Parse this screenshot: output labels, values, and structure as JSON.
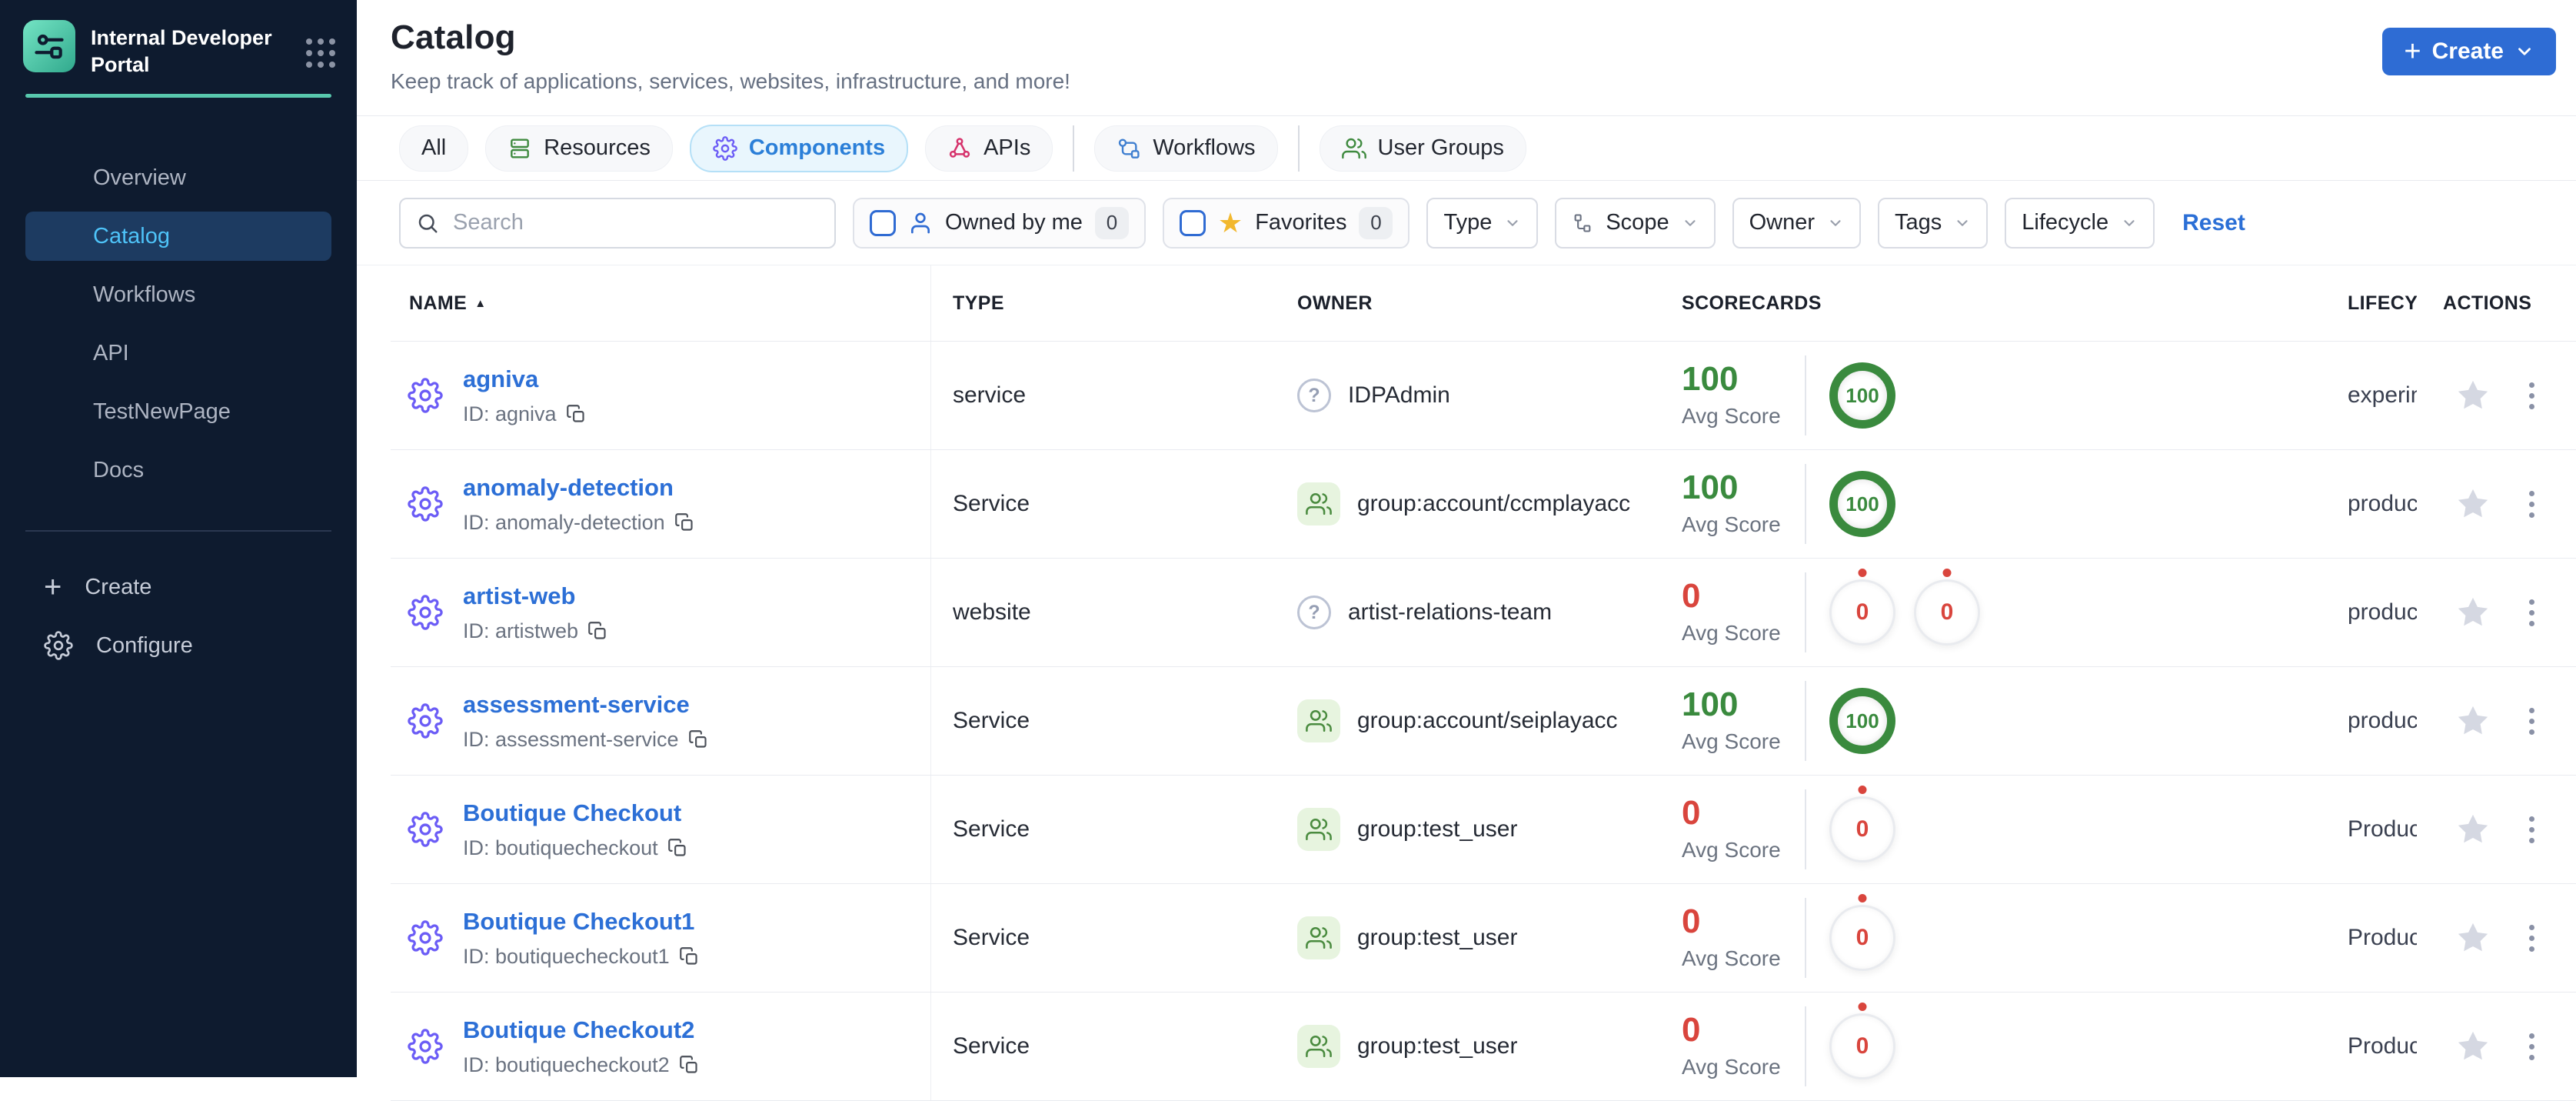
{
  "brand": {
    "title": "Internal Developer Portal"
  },
  "sidebar": {
    "items": [
      {
        "label": "Overview",
        "active": false
      },
      {
        "label": "Catalog",
        "active": true
      },
      {
        "label": "Workflows",
        "active": false
      },
      {
        "label": "API",
        "active": false
      },
      {
        "label": "TestNewPage",
        "active": false
      },
      {
        "label": "Docs",
        "active": false
      }
    ],
    "footer": {
      "create_label": "Create",
      "configure_label": "Configure"
    }
  },
  "header": {
    "title": "Catalog",
    "subtitle": "Keep track of applications, services, websites, infrastructure, and more!",
    "create_label": "Create"
  },
  "tabs": [
    {
      "label": "All",
      "icon": null,
      "selected": false
    },
    {
      "label": "Resources",
      "icon": "resources-icon",
      "selected": false
    },
    {
      "label": "Components",
      "icon": "components-icon",
      "selected": true
    },
    {
      "label": "APIs",
      "icon": "apis-icon",
      "selected": false
    },
    {
      "label": "Workflows",
      "icon": "workflows-icon",
      "selected": false
    },
    {
      "label": "User Groups",
      "icon": "user-groups-icon",
      "selected": false
    }
  ],
  "filters": {
    "search_placeholder": "Search",
    "owned_by_me": {
      "label": "Owned by me",
      "count": "0"
    },
    "favorites": {
      "label": "Favorites",
      "count": "0"
    },
    "dropdowns": {
      "type": "Type",
      "scope": "Scope",
      "owner": "Owner",
      "tags": "Tags",
      "lifecycle": "Lifecycle"
    },
    "reset_label": "Reset"
  },
  "table": {
    "columns": {
      "name": "NAME",
      "type": "TYPE",
      "owner": "OWNER",
      "scorecards": "SCORECARDS",
      "lifecycle": "LIFECYCLE",
      "actions": "ACTIONS"
    },
    "avg_score_label": "Avg Score",
    "rows": [
      {
        "name": "agniva",
        "id_label": "ID: agniva",
        "type": "service",
        "owner": {
          "kind": "user",
          "label": "IDPAdmin"
        },
        "score": {
          "avg": "100",
          "state": "good",
          "rings": [
            {
              "value": "100",
              "state": "good"
            }
          ]
        },
        "lifecycle": "experimental"
      },
      {
        "name": "anomaly-detection",
        "id_label": "ID: anomaly-detection",
        "type": "Service",
        "owner": {
          "kind": "group",
          "label": "group:account/ccmplayacc"
        },
        "score": {
          "avg": "100",
          "state": "good",
          "rings": [
            {
              "value": "100",
              "state": "good"
            }
          ]
        },
        "lifecycle": "production"
      },
      {
        "name": "artist-web",
        "id_label": "ID: artistweb",
        "type": "website",
        "owner": {
          "kind": "user",
          "label": "artist-relations-team"
        },
        "score": {
          "avg": "0",
          "state": "bad",
          "rings": [
            {
              "value": "0",
              "state": "bad"
            },
            {
              "value": "0",
              "state": "bad"
            }
          ]
        },
        "lifecycle": "production"
      },
      {
        "name": "assessment-service",
        "id_label": "ID: assessment-service",
        "type": "Service",
        "owner": {
          "kind": "group",
          "label": "group:account/seiplayacc"
        },
        "score": {
          "avg": "100",
          "state": "good",
          "rings": [
            {
              "value": "100",
              "state": "good"
            }
          ]
        },
        "lifecycle": "production"
      },
      {
        "name": "Boutique Checkout",
        "id_label": "ID: boutiquecheckout",
        "type": "Service",
        "owner": {
          "kind": "group",
          "label": "group:test_user"
        },
        "score": {
          "avg": "0",
          "state": "bad",
          "rings": [
            {
              "value": "0",
              "state": "bad"
            }
          ]
        },
        "lifecycle": "Production"
      },
      {
        "name": "Boutique Checkout1",
        "id_label": "ID: boutiquecheckout1",
        "type": "Service",
        "owner": {
          "kind": "group",
          "label": "group:test_user"
        },
        "score": {
          "avg": "0",
          "state": "bad",
          "rings": [
            {
              "value": "0",
              "state": "bad"
            }
          ]
        },
        "lifecycle": "Production"
      },
      {
        "name": "Boutique Checkout2",
        "id_label": "ID: boutiquecheckout2",
        "type": "Service",
        "owner": {
          "kind": "group",
          "label": "group:test_user"
        },
        "score": {
          "avg": "0",
          "state": "bad",
          "rings": [
            {
              "value": "0",
              "state": "bad"
            }
          ]
        },
        "lifecycle": "Production"
      }
    ]
  },
  "colors": {
    "accent_blue": "#2e6cd4",
    "link_blue": "#2c6fd6",
    "selected_tab_blue": "#2b7fd8",
    "good_green": "#3a8a3e",
    "bad_red": "#d9453d",
    "teal_accent": "#58c8ad",
    "component_purple": "#6b5cf6",
    "api_pink": "#d6336c",
    "resource_green": "#3f8a3f",
    "workflow_blue": "#3f7fd0",
    "sidebar_bg": "#0e1b2f",
    "active_item_text": "#4ec3f8"
  }
}
